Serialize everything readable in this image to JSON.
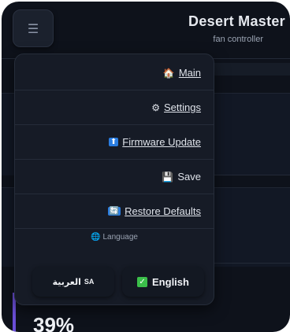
{
  "header": {
    "title": "Desert Master",
    "subtitle": "fan controller",
    "menu_icon": "hamburger-icon"
  },
  "main": {
    "percent": "39%"
  },
  "menu": {
    "items": [
      {
        "label": "Main",
        "icon": "home-icon",
        "glyph": "🏠",
        "underline": true
      },
      {
        "label": "Settings",
        "icon": "gear-icon",
        "glyph": "⚙",
        "underline": true
      },
      {
        "label": "Firmware Update",
        "icon": "upload-icon",
        "glyph": "⬆",
        "underline": true
      },
      {
        "label": "Save",
        "icon": "floppy-icon",
        "glyph": "💾",
        "underline": false
      },
      {
        "label": "Restore Defaults",
        "icon": "restore-icon",
        "glyph": "🔄",
        "underline": true
      }
    ],
    "language": {
      "label": "Language",
      "icon": "globe-icon",
      "options": [
        {
          "label": "العربية",
          "flag": "SA",
          "selected": false
        },
        {
          "label": "English",
          "selected": true
        }
      ]
    }
  },
  "colors": {
    "background": "#0e121b",
    "panel": "#161b26",
    "accent": "#6b4fd8",
    "check": "#3bbf4a"
  }
}
